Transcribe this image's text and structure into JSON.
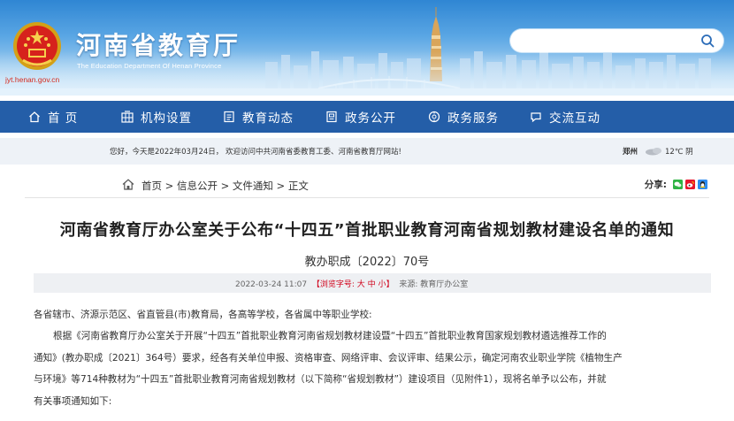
{
  "site": {
    "title": "河南省教育厅",
    "subtitle": "The Education Department Of Henan Province",
    "domain": "jyt.henan.gov.cn"
  },
  "search": {
    "placeholder": "",
    "icon": "search-icon"
  },
  "nav": {
    "items": [
      {
        "label": "首 页",
        "icon": "home-icon"
      },
      {
        "label": "机构设置",
        "icon": "org-icon"
      },
      {
        "label": "教育动态",
        "icon": "news-icon"
      },
      {
        "label": "政务公开",
        "icon": "doc-icon"
      },
      {
        "label": "政务服务",
        "icon": "service-icon"
      },
      {
        "label": "交流互动",
        "icon": "chat-icon"
      }
    ]
  },
  "infobar": {
    "welcome": "您好，今天是2022年03月24日， 欢迎访问中共河南省委教育工委、河南省教育厅网站!",
    "city": "郑州",
    "weather_icon": "cloud-icon",
    "temperature": "12℃ 阴"
  },
  "breadcrumb": {
    "home": "首页",
    "sep": " > ",
    "items": [
      "信息公开",
      "文件通知",
      "正文"
    ]
  },
  "share": {
    "label": "分享:"
  },
  "article": {
    "title": "河南省教育厅办公室关于公布“十四五”首批职业教育河南省规划教材建设名单的通知",
    "doc_number": "教办职成〔2022〕70号",
    "date": "2022-03-24 11:07",
    "font_size_label": "【浏览字号:",
    "font_sizes": [
      "大",
      "中",
      "小"
    ],
    "font_size_close": "】",
    "source": "来源: 教育厅办公室",
    "salutation": "各省辖市、济源示范区、省直管县(市)教育局，各高等学校，各省属中等职业学校:",
    "paragraph1_line1": "根据《河南省教育厅办公室关于开展“十四五”首批职业教育河南省规划教材建设暨“十四五”首批职业教育国家规划教材遴选推荐工作的",
    "paragraph1_line2": "通知》(教办职成〔2021〕364号）要求，经各有关单位申报、资格审查、网络评审、会议评审、结果公示，确定河南农业职业学院《植物生产",
    "paragraph1_line3": "与环境》等714种教材为“十四五”首批职业教育河南省规划教材（以下简称“省规划教材”）建设项目（见附件1），现将名单予以公布，并就",
    "paragraph1_line4": "有关事项通知如下:"
  }
}
